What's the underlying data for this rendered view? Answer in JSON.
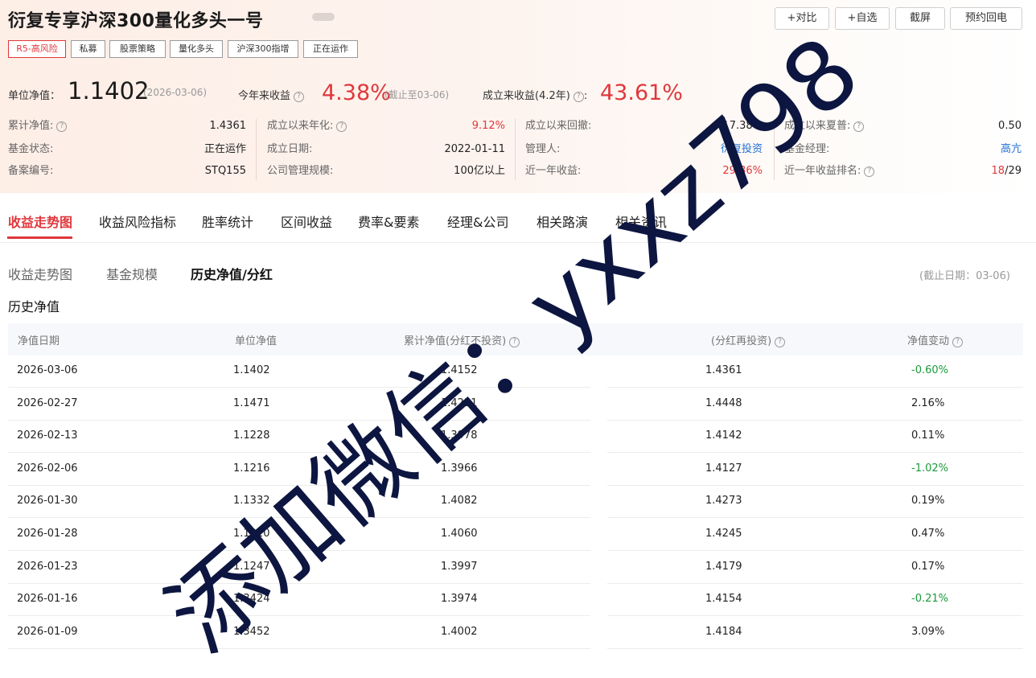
{
  "header": {
    "title": "衍复专享沪深300量化多头一号",
    "buttons": [
      "+对比",
      "+自选",
      "截屏",
      "预约回电"
    ]
  },
  "tags": [
    "R5-高风险",
    "私募",
    "股票策略",
    "量化多头",
    "沪深300指增",
    "正在运作"
  ],
  "nav": {
    "label": "单位净值：",
    "value": "1.1402",
    "date": "(2026-03-06)",
    "ytd_label": "今年来收益",
    "ytd_value": "4.38%",
    "ytd_note": "(截止至03-06)",
    "since_label": "成立来收益(4.2年)",
    "since_value": "43.61%"
  },
  "stats": [
    {
      "label": "累计净值:",
      "value": "1.4361",
      "help": true
    },
    {
      "label": "成立以来年化:",
      "value": "9.12%",
      "help": true,
      "color": "red"
    },
    {
      "label": "成立以来回撤:",
      "value": "17.38%"
    },
    {
      "label": "成立以来夏普:",
      "value": "0.50",
      "help": true
    },
    {
      "label": "基金状态:",
      "value": "正在运作"
    },
    {
      "label": "成立日期:",
      "value": "2022-01-11"
    },
    {
      "label": "管理人:",
      "value": "衍复投资",
      "color": "blue"
    },
    {
      "label": "基金经理:",
      "value": "高亢",
      "color": "blue"
    },
    {
      "label": "备案编号:",
      "value": "STQ155"
    },
    {
      "label": "公司管理规模:",
      "value": "100亿以上"
    },
    {
      "label": "近一年收益:",
      "value": "29.36%",
      "color": "red"
    },
    {
      "label": "近一年收益排名:",
      "value_a": "18",
      "value_b": "/29",
      "help": true
    }
  ],
  "tabs": [
    "收益走势图",
    "收益风险指标",
    "胜率统计",
    "区间收益",
    "费率&要素",
    "经理&公司",
    "相关路演",
    "相关资讯"
  ],
  "subtabs": [
    "收益走势图",
    "基金规模",
    "历史净值/分红"
  ],
  "cutoff": "(截止日期：03-06)",
  "section_title": "历史净值",
  "table": {
    "headers": [
      "净值日期",
      "单位净值",
      "累计净值(分红不投资)",
      "(分红再投资)",
      "净值变动"
    ],
    "rows": [
      [
        "2026-03-06",
        "1.1402",
        "1.4152",
        "1.4361",
        "-0.60%"
      ],
      [
        "2026-02-27",
        "1.1471",
        "1.4221",
        "1.4448",
        "2.16%"
      ],
      [
        "2026-02-13",
        "1.1228",
        "1.3978",
        "1.4142",
        "0.11%"
      ],
      [
        "2026-02-06",
        "1.1216",
        "1.3966",
        "1.4127",
        "-1.02%"
      ],
      [
        "2026-01-30",
        "1.1332",
        "1.4082",
        "1.4273",
        "0.19%"
      ],
      [
        "2026-01-28",
        "1.1310",
        "1.4060",
        "1.4245",
        "0.47%"
      ],
      [
        "2026-01-23",
        "1.1247",
        "1.3997",
        "1.4179",
        "0.17%"
      ],
      [
        "2026-01-16",
        "1.3424",
        "1.3974",
        "1.4154",
        "-0.21%"
      ],
      [
        "2026-01-09",
        "1.3452",
        "1.4002",
        "1.4184",
        "3.09%"
      ]
    ]
  },
  "watermark": "添加微信：yxxz798",
  "colors": {
    "accent": "#e0373c",
    "up": "#e0373c",
    "down": "#1a9b3a",
    "link": "#1f6fd6"
  }
}
